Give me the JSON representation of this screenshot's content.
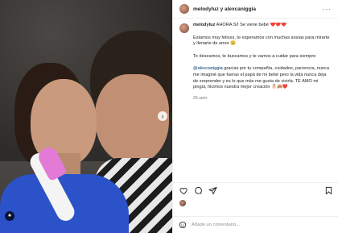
{
  "header": {
    "usernames": "melodyluz y alexcaniggia",
    "more_icon": "more-dots-icon"
  },
  "caption": {
    "username": "melodyluz",
    "headline": "AHORA SI! Se viene bebé ❤️❤️❤️",
    "paragraph1": "Estamos muy felices, te esperamos con muchas ansias para mirarte y llenarte de amor 🥺",
    "paragraph2": "Te deseamos, te buscamos y te vamos a cuidar para siempre",
    "mention": "@alexcaniggia",
    "paragraph3": " gracias por tu compañía, cuidados, paciencia, nunca me imaginé que fueras el papá de mi bebé pero la vida nunca deja de sorprender y es lo que más me gusta de vivirla. TE AMO mi pingüi, hicimos nuestra mejor creación 👶🏻🙈❤️",
    "timestamp": "26 sem"
  },
  "actions": {
    "like_icon": "heart-icon",
    "comment_icon": "comment-icon",
    "share_icon": "share-icon",
    "save_icon": "bookmark-icon"
  },
  "comment_box": {
    "placeholder": "Añade un comentario..."
  },
  "colors": {
    "heart_red": "#ed4956",
    "text_dark": "#262626",
    "text_muted": "#737373",
    "mention_blue": "#00376b",
    "divider": "#efefef"
  }
}
